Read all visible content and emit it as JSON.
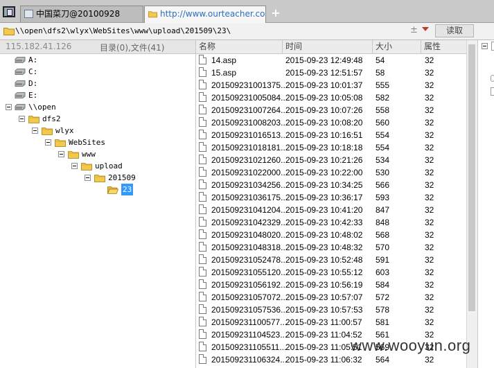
{
  "tabs": [
    {
      "label": "中国菜刀@20100928"
    },
    {
      "label": "http://www.ourteacher.com.c..."
    }
  ],
  "new_tab_label": "+",
  "address": {
    "value": "\\\\open\\dfs2\\wlyx\\WebSites\\www\\upload\\201509\\23\\",
    "history_glyph": "±",
    "read_button": "读取"
  },
  "left": {
    "ip": "115.182.41.126",
    "counts": "目录(0),文件(41)"
  },
  "tree": [
    {
      "label": "A:",
      "type": "drive"
    },
    {
      "label": "C:",
      "type": "drive"
    },
    {
      "label": "D:",
      "type": "drive"
    },
    {
      "label": "E:",
      "type": "drive"
    },
    {
      "label": "\\\\open",
      "type": "drive"
    },
    {
      "label": "dfs2",
      "type": "folder"
    },
    {
      "label": "wlyx",
      "type": "folder"
    },
    {
      "label": "WebSites",
      "type": "folder"
    },
    {
      "label": "www",
      "type": "folder"
    },
    {
      "label": "upload",
      "type": "folder"
    },
    {
      "label": "201509",
      "type": "folder"
    },
    {
      "label": "23",
      "type": "folder-open"
    }
  ],
  "columns": {
    "name": "名称",
    "time": "时间",
    "size": "大小",
    "attr": "属性"
  },
  "files": [
    {
      "name": "14.asp",
      "time": "2015-09-23 12:49:48",
      "size": "54",
      "attr": "32"
    },
    {
      "name": "15.asp",
      "time": "2015-09-23 12:51:57",
      "size": "58",
      "attr": "32"
    },
    {
      "name": "201509231001375...",
      "time": "2015-09-23 10:01:37",
      "size": "555",
      "attr": "32"
    },
    {
      "name": "201509231005084...",
      "time": "2015-09-23 10:05:08",
      "size": "582",
      "attr": "32"
    },
    {
      "name": "201509231007264...",
      "time": "2015-09-23 10:07:26",
      "size": "558",
      "attr": "32"
    },
    {
      "name": "201509231008203...",
      "time": "2015-09-23 10:08:20",
      "size": "560",
      "attr": "32"
    },
    {
      "name": "201509231016513...",
      "time": "2015-09-23 10:16:51",
      "size": "554",
      "attr": "32"
    },
    {
      "name": "201509231018181...",
      "time": "2015-09-23 10:18:18",
      "size": "554",
      "attr": "32"
    },
    {
      "name": "201509231021260...",
      "time": "2015-09-23 10:21:26",
      "size": "534",
      "attr": "32"
    },
    {
      "name": "201509231022000...",
      "time": "2015-09-23 10:22:00",
      "size": "530",
      "attr": "32"
    },
    {
      "name": "201509231034256...",
      "time": "2015-09-23 10:34:25",
      "size": "566",
      "attr": "32"
    },
    {
      "name": "201509231036175...",
      "time": "2015-09-23 10:36:17",
      "size": "593",
      "attr": "32"
    },
    {
      "name": "201509231041204...",
      "time": "2015-09-23 10:41:20",
      "size": "847",
      "attr": "32"
    },
    {
      "name": "201509231042329...",
      "time": "2015-09-23 10:42:33",
      "size": "848",
      "attr": "32"
    },
    {
      "name": "201509231048020...",
      "time": "2015-09-23 10:48:02",
      "size": "568",
      "attr": "32"
    },
    {
      "name": "201509231048318...",
      "time": "2015-09-23 10:48:32",
      "size": "570",
      "attr": "32"
    },
    {
      "name": "201509231052478...",
      "time": "2015-09-23 10:52:48",
      "size": "591",
      "attr": "32"
    },
    {
      "name": "201509231055120...",
      "time": "2015-09-23 10:55:12",
      "size": "603",
      "attr": "32"
    },
    {
      "name": "201509231056192...",
      "time": "2015-09-23 10:56:19",
      "size": "584",
      "attr": "32"
    },
    {
      "name": "201509231057072...",
      "time": "2015-09-23 10:57:07",
      "size": "572",
      "attr": "32"
    },
    {
      "name": "201509231057536...",
      "time": "2015-09-23 10:57:53",
      "size": "578",
      "attr": "32"
    },
    {
      "name": "201509231100577...",
      "time": "2015-09-23 11:00:57",
      "size": "581",
      "attr": "32"
    },
    {
      "name": "201509231104523...",
      "time": "2015-09-23 11:04:52",
      "size": "561",
      "attr": "32"
    },
    {
      "name": "201509231105511...",
      "time": "2015-09-23 11:05:51",
      "size": "569",
      "attr": "32"
    },
    {
      "name": "201509231106324...",
      "time": "2015-09-23 11:06:32",
      "size": "564",
      "attr": "32"
    }
  ],
  "watermark": "www.wooyun.org",
  "icons": {
    "app": "app-window-icon",
    "tab1": "window-icon",
    "tab2": "folder-icon",
    "address": "folder-icon",
    "dropdown": "triangle-down-icon",
    "file": "file-icon"
  },
  "colors": {
    "selection": "#3399ff",
    "folder": "#f2c94c",
    "link": "#2c6fbf",
    "dropdown": "#c0392b"
  }
}
